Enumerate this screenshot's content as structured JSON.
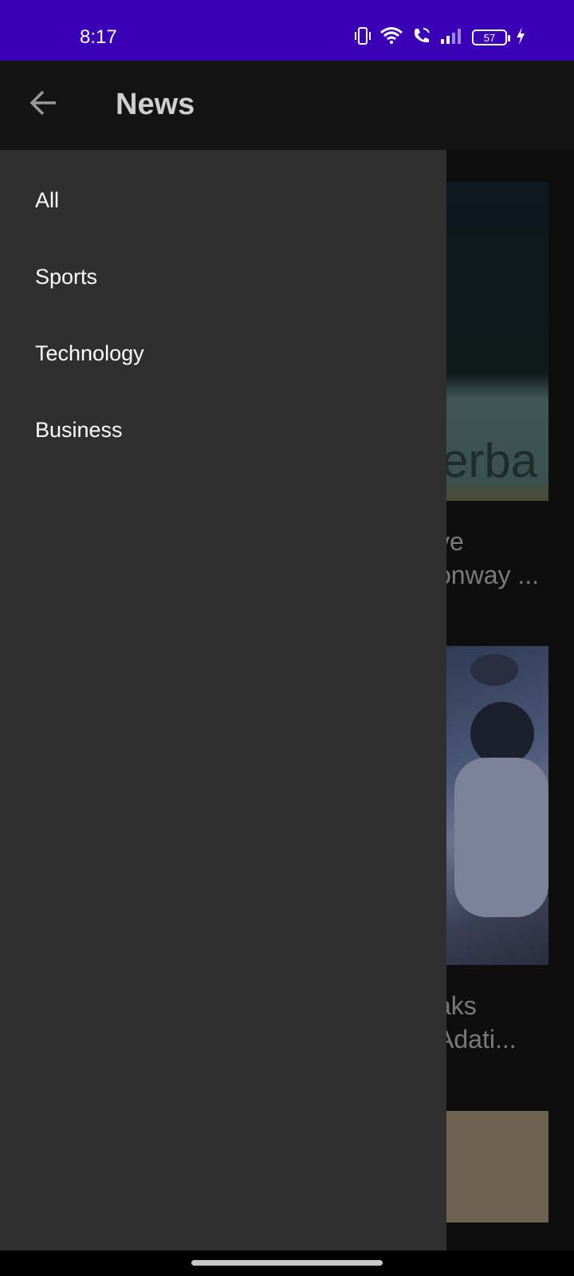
{
  "status_bar": {
    "time": "8:17",
    "battery": "57",
    "icons": [
      "vibrate-icon",
      "wifi-icon",
      "wifi-call-icon",
      "signal-icon",
      "battery-icon",
      "charging-icon"
    ]
  },
  "app_bar": {
    "title": "News",
    "back_icon": "arrow-left-icon"
  },
  "drawer": {
    "items": [
      {
        "label": "All"
      },
      {
        "label": "Sports"
      },
      {
        "label": "Technology"
      },
      {
        "label": "Business"
      }
    ]
  },
  "feed": {
    "cards": [
      {
        "image_text": "erba",
        "title_line1": "ve",
        "title_line2": "onway ..."
      },
      {
        "title_line1": "aks",
        "title_line2": " Adati..."
      }
    ]
  },
  "colors": {
    "status_bar": "#3a00b8",
    "app_bar": "#141414",
    "drawer": "#2f2f2f",
    "scrim": "#0e0e0e"
  }
}
